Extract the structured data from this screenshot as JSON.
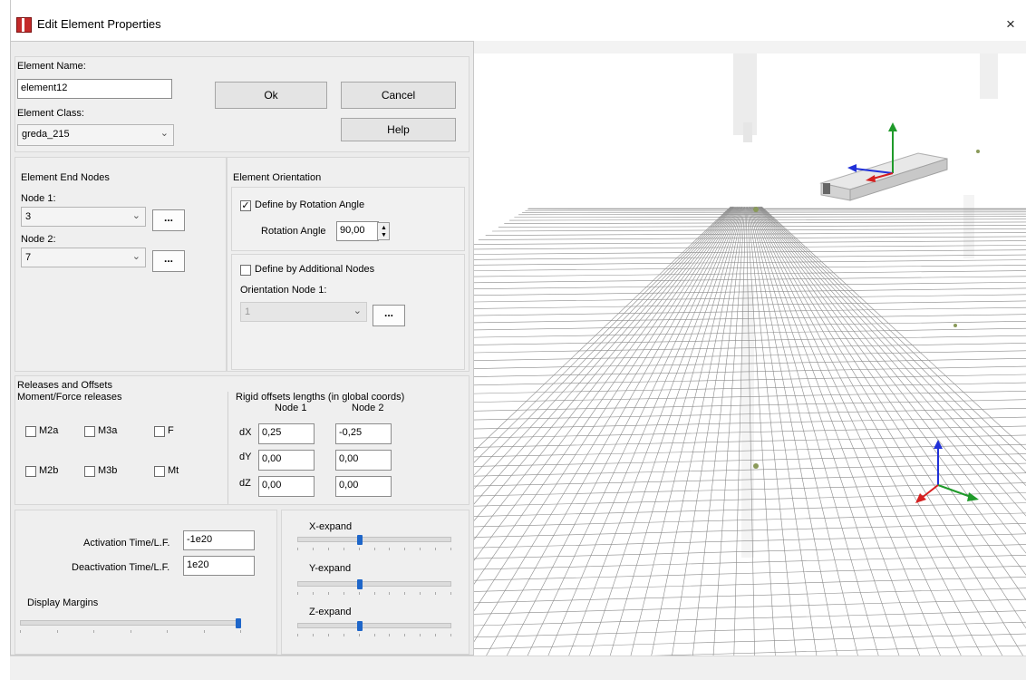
{
  "window": {
    "title": "Edit Element Properties",
    "close_glyph": "×"
  },
  "element": {
    "name_label": "Element Name:",
    "name_value": "element12",
    "class_label": "Element Class:",
    "class_value": "greda_215"
  },
  "buttons": {
    "ok": "Ok",
    "cancel": "Cancel",
    "help": "Help",
    "dots": "..."
  },
  "end_nodes": {
    "title": "Element End Nodes",
    "node1_label": "Node 1:",
    "node1_value": "3",
    "node2_label": "Node 2:",
    "node2_value": "7"
  },
  "orientation": {
    "title": "Element Orientation",
    "by_angle_label": "Define by Rotation Angle",
    "by_angle_checked": true,
    "angle_label": "Rotation Angle",
    "angle_value": "90,00",
    "by_nodes_label": "Define by Additional Nodes",
    "by_nodes_checked": false,
    "orient_node_label": "Orientation Node 1:",
    "orient_node_value": "1"
  },
  "releases": {
    "title": "Releases and Offsets",
    "moment_title": "Moment/Force releases",
    "items": [
      "M2a",
      "M3a",
      "F",
      "M2b",
      "M3b",
      "Mt"
    ],
    "offsets_title": "Rigid offsets lengths (in global coords)",
    "col1": "Node 1",
    "col2": "Node 2",
    "rows": [
      {
        "axis": "dX",
        "n1": "0,25",
        "n2": "-0,25"
      },
      {
        "axis": "dY",
        "n1": "0,00",
        "n2": "0,00"
      },
      {
        "axis": "dZ",
        "n1": "0,00",
        "n2": "0,00"
      }
    ]
  },
  "times": {
    "activation_label": "Activation Time/L.F.",
    "activation_value": "-1e20",
    "deactivation_label": "Deactivation Time/L.F.",
    "deactivation_value": "1e20"
  },
  "margins": {
    "label": "Display Margins",
    "level_fraction": 1.0
  },
  "expand": {
    "x_label": "X-expand",
    "x_level": 0.4,
    "y_label": "Y-expand",
    "y_level": 0.4,
    "z_label": "Z-expand",
    "z_level": 0.4
  },
  "colors": {
    "accent": "#1e66c9",
    "axis_x": "#d62020",
    "axis_y": "#1f9a2a",
    "axis_z": "#2030d8"
  }
}
